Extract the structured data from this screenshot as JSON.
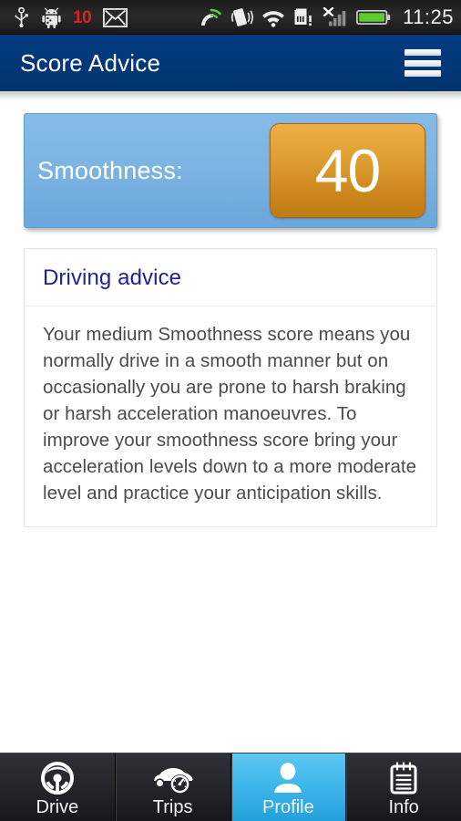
{
  "statusbar": {
    "icons_left": [
      "usb-icon",
      "android-debug-icon",
      "gmail-icon"
    ],
    "notification_count": "10",
    "icons_right": [
      "gps-icon",
      "vibrate-icon",
      "wifi-icon",
      "sdcard-warning-icon",
      "signal-no-service-icon",
      "battery-icon"
    ],
    "time": "11:25"
  },
  "header": {
    "title": "Score Advice",
    "menu_icon": "hamburger-menu-icon"
  },
  "score": {
    "label": "Smoothness:",
    "value": "40",
    "card_color": "#7db4e2",
    "badge_color": "#d99428"
  },
  "advice": {
    "title": "Driving advice",
    "title_color": "#1f1f9e",
    "text": "Your medium Smoothness score means you normally drive in a smooth manner but on occasionally you are prone to harsh braking or harsh acceleration manoeuvres. To improve your smoothness score bring your acceleration levels down to a more moderate level and practice your anticipation skills."
  },
  "tabbar": {
    "active_color": "#40b7ea",
    "items": [
      {
        "label": "Drive",
        "icon": "steering-wheel-icon",
        "active": false
      },
      {
        "label": "Trips",
        "icon": "car-speedometer-icon",
        "active": false
      },
      {
        "label": "Profile",
        "icon": "person-icon",
        "active": true
      },
      {
        "label": "Info",
        "icon": "notepad-icon",
        "active": false
      }
    ]
  }
}
